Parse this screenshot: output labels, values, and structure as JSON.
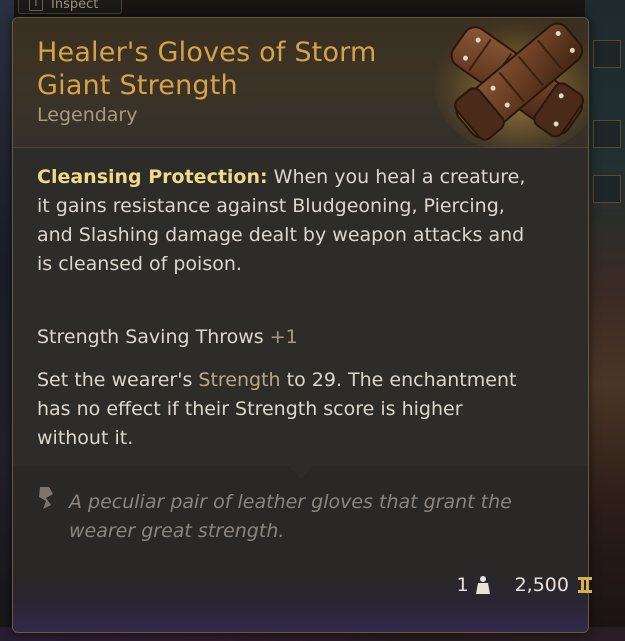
{
  "inspect_tab": {
    "key": "I",
    "label": "Inspect"
  },
  "item": {
    "name": "Healer's Gloves of Storm Giant Strength",
    "rarity": "Legendary",
    "rarity_color": "#d6a24a"
  },
  "passive": {
    "title": "Cleansing Protection:",
    "description": "When you heal a creature, it gains resistance against Bludgeoning, Piercing, and Slashing damage dealt by weapon attacks and is cleansed of poison."
  },
  "bonus": {
    "label": "Strength Saving Throws",
    "value": "+1"
  },
  "enchantment": {
    "prefix": "Set the wearer's",
    "stat": "Strength",
    "suffix": "to 29. The enchantment has no effect if their Strength score is higher without it."
  },
  "flavor": "A peculiar pair of leather gloves that grant the wearer great strength.",
  "footer": {
    "weight": "1",
    "weight_icon": "weight-icon",
    "value": "2,500",
    "value_icon": "gold-coin-icon"
  }
}
